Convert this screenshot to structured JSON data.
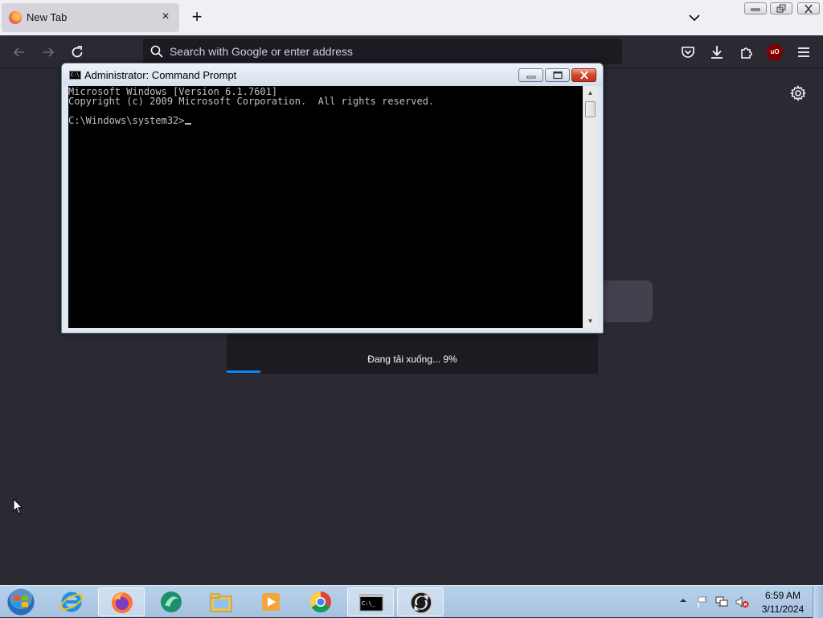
{
  "browser": {
    "tab": {
      "title": "New Tab",
      "close_label": "×"
    },
    "new_tab_label": "+",
    "urlbar": {
      "placeholder": "Search with Google or enter address",
      "value": ""
    },
    "extension_badge": "uO"
  },
  "download": {
    "status_text": "Đang tải xuống... 9%",
    "progress": 0.09
  },
  "cmd_window": {
    "title": "Administrator: Command Prompt",
    "icon_text": "C:\\",
    "lines": [
      "Microsoft Windows [Version 6.1.7601]",
      "Copyright (c) 2009 Microsoft Corporation.  All rights reserved.",
      "",
      "C:\\Windows\\system32>"
    ]
  },
  "taskbar": {
    "clock_time": "6:59 AM",
    "clock_date": "3/11/2024",
    "items": [
      "internet-explorer",
      "firefox",
      "app-green",
      "file-explorer",
      "media-player",
      "chrome",
      "command-prompt",
      "app-sync"
    ]
  },
  "colors": {
    "firefox_bg": "#2b2a33",
    "progress": "#0a84ff",
    "cmd_close": "#c4331c"
  }
}
